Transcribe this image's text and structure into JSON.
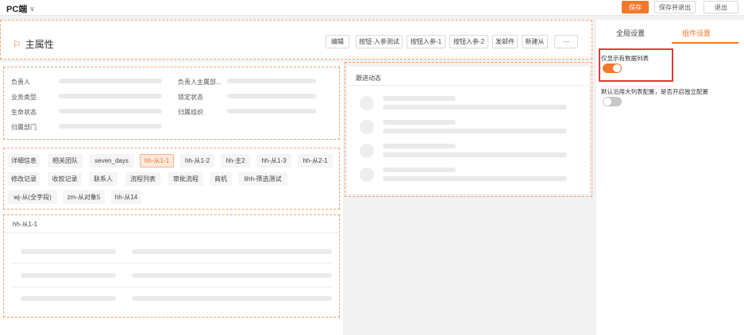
{
  "topbar": {
    "title": "PC端",
    "save_label": "保存",
    "save_exit_label": "保存并退出",
    "exit_label": "退出"
  },
  "header": {
    "title": "主属性",
    "buttons": [
      "编辑",
      "按钮-入参测试",
      "按钮入参-1",
      "按钮入参-2",
      "发邮件",
      "新建从",
      "···"
    ]
  },
  "fields": [
    "负责人",
    "负责人主属部...",
    "业务类型",
    "锁定状态",
    "生命状态",
    "归属组织",
    "归属部门"
  ],
  "tabs": [
    "详细信息",
    "相关团队",
    "seven_days",
    "hh-从1-1",
    "hh-从1-2",
    "hh-主2",
    "hh-从1-3",
    "hh-从2-1",
    "修改记录",
    "收款记录",
    "联系人",
    "流程列表",
    "审批流程",
    "商机",
    "lihh-筛选测试",
    "wj-从(全字段)",
    "zm-从对象5",
    "hh-从14"
  ],
  "sub_section": {
    "title": "hh-从1-1"
  },
  "follow": {
    "title": "跟进动态"
  },
  "panel": {
    "tab_global": "全局设置",
    "tab_component": "组件设置",
    "option1_label": "仅显示有数据列表",
    "option1_on": true,
    "option2_label": "默认沿用大列表配置，是否开启独立配置",
    "option2_on": false
  },
  "colors": {
    "accent": "#f2782c",
    "highlight": "#e23a3a"
  }
}
